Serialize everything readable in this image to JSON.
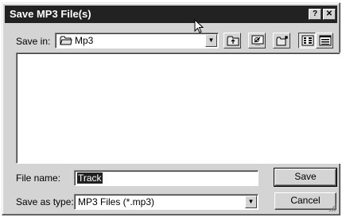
{
  "window": {
    "title": "Save MP3 File(s)",
    "help_label": "?",
    "close_label": "✕"
  },
  "save_in": {
    "label": "Save in:",
    "value": "Mp3"
  },
  "file_list": {
    "items": []
  },
  "file_name": {
    "label": "File name:",
    "value": "Track"
  },
  "save_as_type": {
    "label": "Save as type:",
    "value": "MP3 Files (*.mp3)"
  },
  "buttons": {
    "save": "Save",
    "cancel": "Cancel"
  },
  "icons": {
    "up": "up-one-level-icon",
    "desktop": "desktop-icon",
    "new_folder": "create-new-folder-icon",
    "list": "list-view-icon",
    "details": "details-view-icon",
    "folder": "folder-icon",
    "dropdown": "dropdown-arrow-icon",
    "cursor": "mouse-pointer-icon"
  }
}
